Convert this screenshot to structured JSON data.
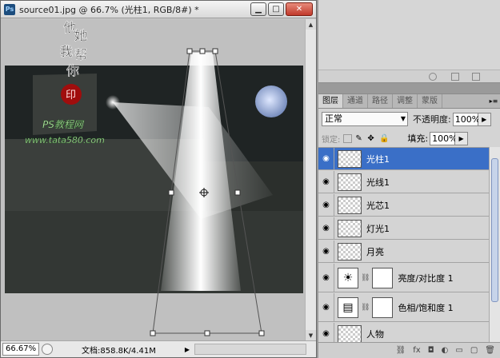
{
  "document": {
    "title": "source01.jpg @ 66.7% (光柱1, RGB/8#) *",
    "ps_logo": "Ps",
    "controls": {
      "minimize": "▁",
      "maximize": "□",
      "close": "✕"
    },
    "status": {
      "zoom": "66.67%",
      "doc_info": "文档:858.8K/4.41M",
      "arrow": "▶"
    }
  },
  "watermark": {
    "chars": [
      "他",
      "她",
      "我",
      "帮",
      "你"
    ],
    "seal": "印",
    "site_title": "PS教程网",
    "site_url": "www.tata580.com"
  },
  "layers_panel": {
    "tabs": [
      "图层",
      "通道",
      "路径",
      "调整",
      "蒙版"
    ],
    "active_tab": 0,
    "menu_icon": "▸≡",
    "blend_mode": "正常",
    "opacity_label": "不透明度:",
    "opacity_value": "100%",
    "lock_label": "锁定:",
    "fill_label": "填充:",
    "fill_value": "100%",
    "layers": [
      {
        "name": "光柱1",
        "selected": true,
        "type": "normal"
      },
      {
        "name": "光线1",
        "selected": false,
        "type": "normal"
      },
      {
        "name": "光芯1",
        "selected": false,
        "type": "normal"
      },
      {
        "name": "灯光1",
        "selected": false,
        "type": "normal"
      },
      {
        "name": "月亮",
        "selected": false,
        "type": "normal"
      },
      {
        "name": "亮度/对比度 1",
        "selected": false,
        "type": "adjustment",
        "icon": "☀"
      },
      {
        "name": "色相/饱和度 1",
        "selected": false,
        "type": "adjustment",
        "icon": "▤"
      },
      {
        "name": "人物",
        "selected": false,
        "type": "normal"
      }
    ],
    "footer_icons": [
      "⛓",
      "fx",
      "◘",
      "◐",
      "▭",
      "▢",
      "🗑"
    ]
  },
  "colors": {
    "selection": "#3a6fc7",
    "panel_bg": "#d4d4d4",
    "moon": "#9fb3d9"
  }
}
